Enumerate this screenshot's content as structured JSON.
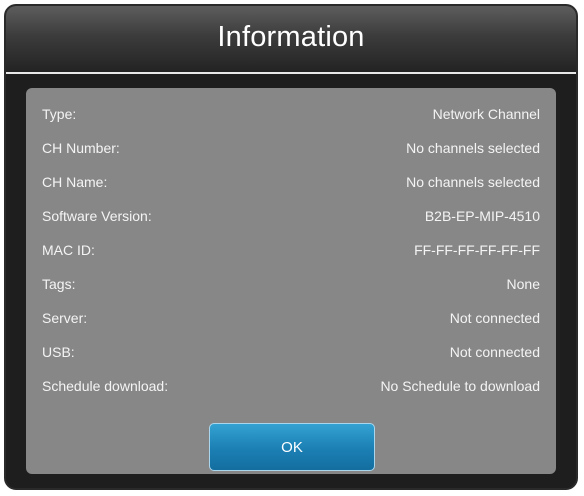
{
  "dialog": {
    "title": "Information",
    "rows": [
      {
        "label": "Type:",
        "value": "Network Channel"
      },
      {
        "label": "CH Number:",
        "value": "No channels selected"
      },
      {
        "label": "CH Name:",
        "value": "No channels selected"
      },
      {
        "label": "Software Version:",
        "value": "B2B-EP-MIP-4510"
      },
      {
        "label": "MAC ID:",
        "value": "FF-FF-FF-FF-FF-FF"
      },
      {
        "label": "Tags:",
        "value": "None"
      },
      {
        "label": "Server:",
        "value": "Not connected"
      },
      {
        "label": "USB:",
        "value": "Not connected"
      },
      {
        "label": "Schedule download:",
        "value": "No Schedule to download"
      }
    ],
    "ok_label": "OK"
  },
  "colors": {
    "panel": "#878787",
    "button": "#1b7fb4",
    "titlebar": "#3c3c3c"
  }
}
